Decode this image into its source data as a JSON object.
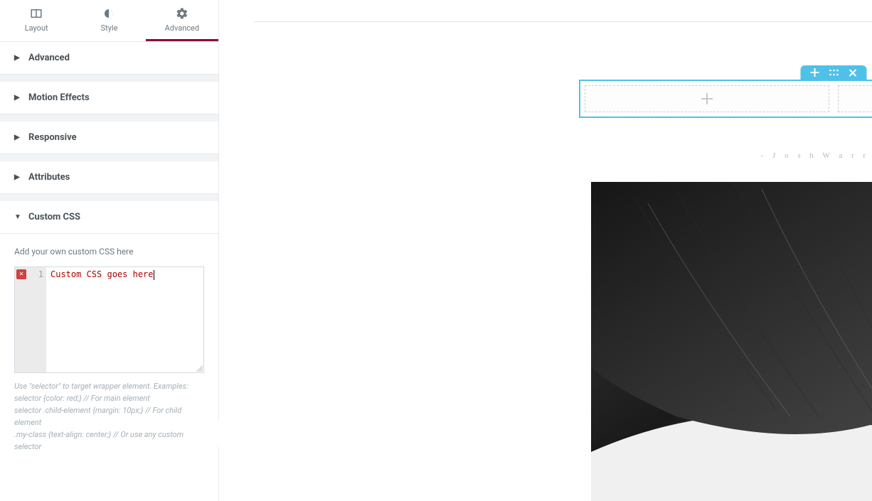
{
  "tabs": {
    "layout": "Layout",
    "style": "Style",
    "advanced": "Advanced"
  },
  "sections": {
    "advanced": "Advanced",
    "motion_effects": "Motion Effects",
    "responsive": "Responsive",
    "attributes": "Attributes",
    "custom_css": "Custom CSS"
  },
  "custom_css": {
    "label": "Add your own custom CSS here",
    "line_number": "1",
    "error_badge": "✕",
    "code": "Custom CSS goes here",
    "help1": "Use \"selector\" to target wrapper element. Examples:",
    "help2": "selector {color: red;} // For main element",
    "help3": "selector .child-element {margin: 10px;} // For child element",
    "help4": ".my-class {text-align: center;} // Or use any custom selector"
  },
  "canvas": {
    "author_line": "- J o s h   W a r r e n -"
  }
}
